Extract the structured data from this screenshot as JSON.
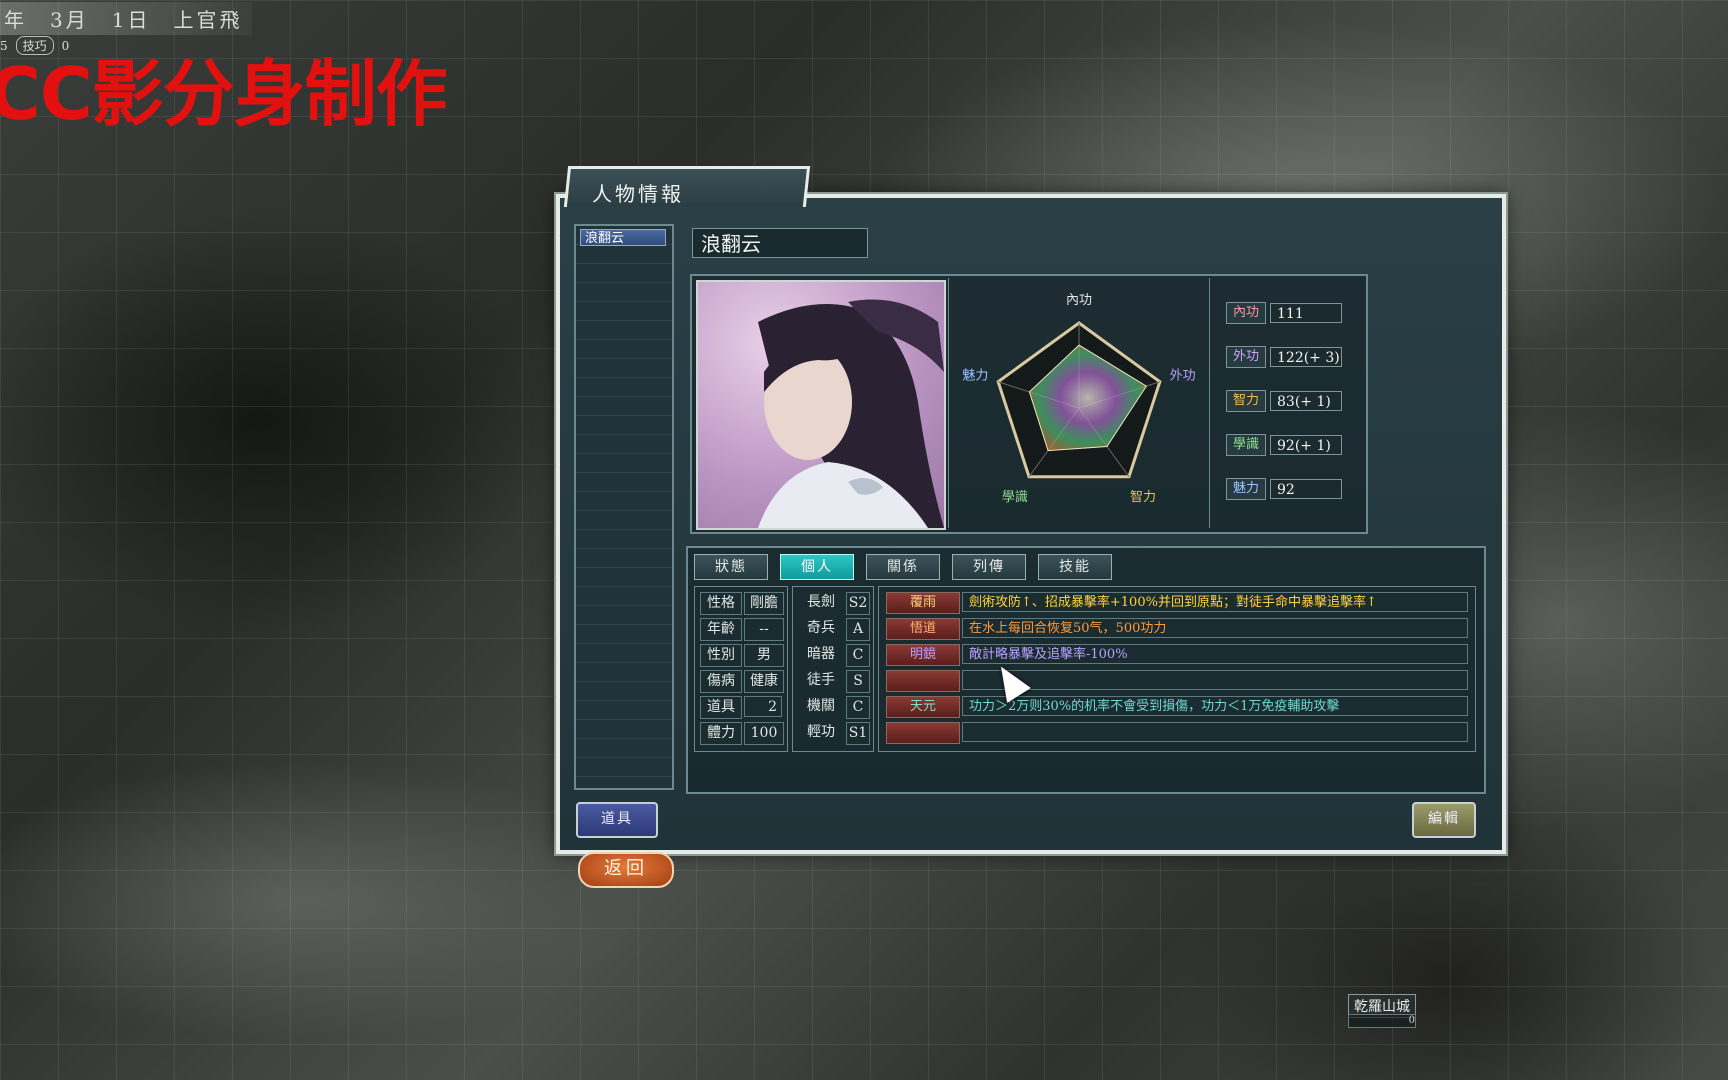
{
  "hud": {
    "date": "年　3月　1日　上官飛",
    "bar_left": "5",
    "bar_label": "技巧",
    "bar_value": "0"
  },
  "watermark": "CC影分身制作",
  "map": {
    "city_label": "乾羅山城",
    "city_value": "0"
  },
  "dialog": {
    "title": "人物情報",
    "list_items": [
      "浪翻云"
    ],
    "character_name": "浪翻云",
    "radar": {
      "labels": [
        "內功",
        "外功",
        "智力",
        "學識",
        "魅力"
      ],
      "label_colors": [
        "#e8e8e8",
        "#b9a0ff",
        "#f0c14a",
        "#8fd68f",
        "#9ec6ff"
      ],
      "values": [
        111,
        125,
        84,
        93,
        92
      ]
    },
    "stats": [
      {
        "label": "內功",
        "value": "111",
        "color": "#ff9a9a"
      },
      {
        "label": "外功",
        "value": "122(+ 3)",
        "color": "#c9a6ff"
      },
      {
        "label": "智力",
        "value": "83(+ 1)",
        "color": "#f3c04a"
      },
      {
        "label": "學識",
        "value": "92(+ 1)",
        "color": "#8fe08f"
      },
      {
        "label": "魅力",
        "value": "92",
        "color": "#9ec6ff"
      }
    ],
    "tabs": [
      {
        "label": "狀態",
        "active": false
      },
      {
        "label": "個人",
        "active": true
      },
      {
        "label": "關係",
        "active": false
      },
      {
        "label": "列傳",
        "active": false
      },
      {
        "label": "技能",
        "active": false
      }
    ],
    "attributes": [
      {
        "label": "性格",
        "value": "剛膽"
      },
      {
        "label": "年齡",
        "value": "--"
      },
      {
        "label": "性別",
        "value": "男"
      },
      {
        "label": "傷病",
        "value": "健康"
      },
      {
        "label": "道具",
        "value": "2"
      },
      {
        "label": "體力",
        "value": "100"
      }
    ],
    "weapons": [
      {
        "label": "長劍",
        "rank": "S2"
      },
      {
        "label": "奇兵",
        "rank": "A"
      },
      {
        "label": "暗器",
        "rank": "C"
      },
      {
        "label": "徒手",
        "rank": "S"
      },
      {
        "label": "機關",
        "rank": "C"
      },
      {
        "label": "輕功",
        "rank": "S1"
      }
    ],
    "skills": [
      {
        "tag": "覆雨",
        "tag_color": "#ffd27a",
        "desc": "劍術攻防↑、招成暴擊率+100%并回到原點；對徒手命中暴擊追擊率↑",
        "desc_color": "#ffd23a"
      },
      {
        "tag": "悟道",
        "tag_color": "#ffb36a",
        "desc": "在水上每回合恢复50气，500功力",
        "desc_color": "#ff9a3a"
      },
      {
        "tag": "明鏡",
        "tag_color": "#b9a0ff",
        "desc": "敵計略暴擊及追擊率-100%",
        "desc_color": "#b9a0ff"
      },
      {
        "tag": "",
        "tag_color": "#ffffff",
        "desc": "",
        "desc_color": "#ffffff"
      },
      {
        "tag": "天元",
        "tag_color": "#7ee0c8",
        "desc": "功力＞2万则30%的机率不會受到損傷，功力＜1万免疫輔助攻擊",
        "desc_color": "#6fd8d0"
      },
      {
        "tag": "",
        "tag_color": "#ffffff",
        "desc": "",
        "desc_color": "#ffffff"
      }
    ],
    "item_button": "道具",
    "edit_button": "編輯",
    "back_button": "返回"
  }
}
